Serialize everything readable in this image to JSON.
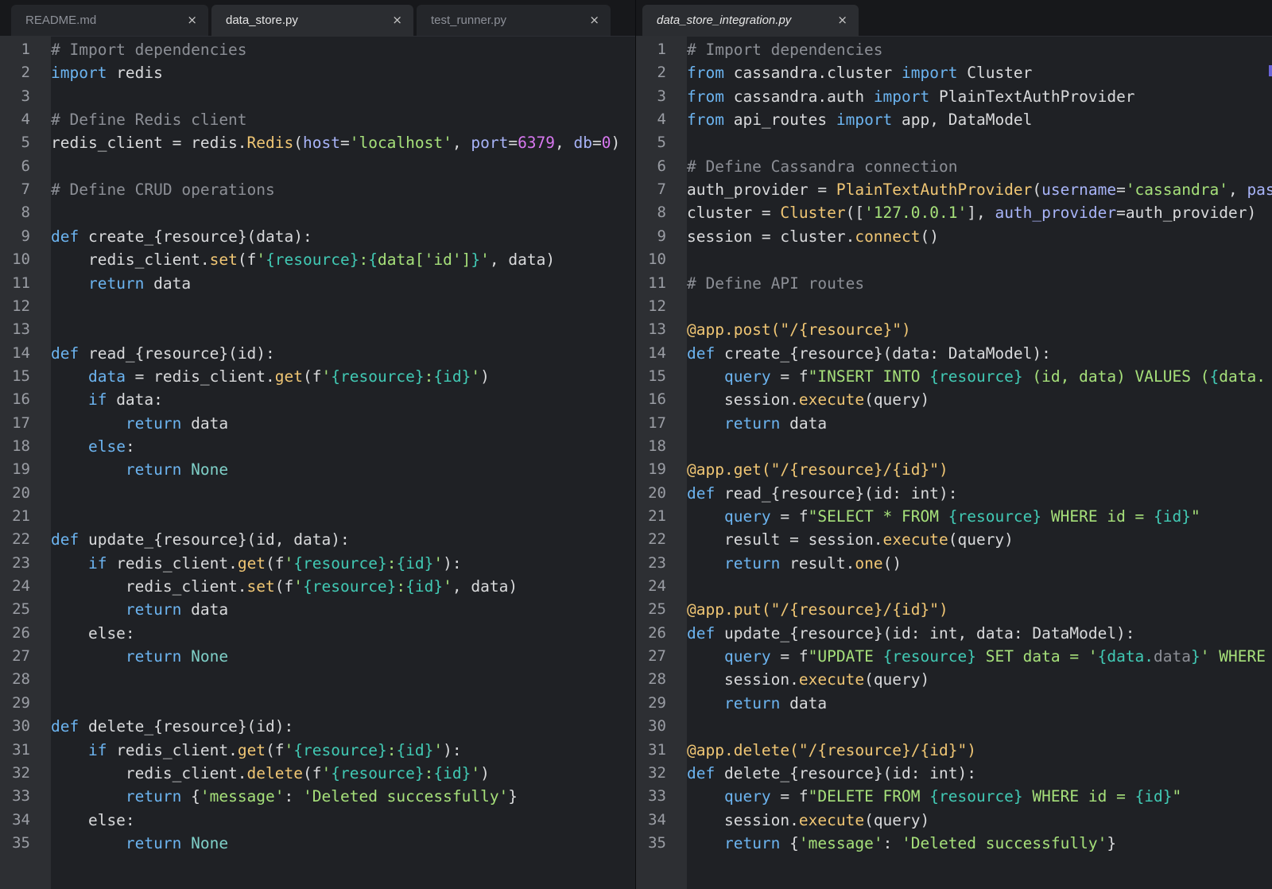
{
  "window": {
    "title": "data_store_integration.py"
  },
  "panes": [
    {
      "id": "left",
      "tabs": [
        {
          "label": "README.md",
          "active": false
        },
        {
          "label": "data_store.py",
          "active": true
        },
        {
          "label": "test_runner.py",
          "active": false
        }
      ],
      "close_glyph": "×",
      "lines": [
        [
          {
            "t": "cm",
            "v": "# Import dependencies"
          }
        ],
        [
          {
            "t": "kw",
            "v": "import"
          },
          {
            "t": "tx",
            "v": " redis"
          }
        ],
        [],
        [
          {
            "t": "cm",
            "v": "# Define Redis client"
          }
        ],
        [
          {
            "t": "tx",
            "v": "redis_client = redis."
          },
          {
            "t": "cls",
            "v": "Redis"
          },
          {
            "t": "tx",
            "v": "("
          },
          {
            "t": "arg",
            "v": "host"
          },
          {
            "t": "tx",
            "v": "="
          },
          {
            "t": "str",
            "v": "'localhost'"
          },
          {
            "t": "tx",
            "v": ", "
          },
          {
            "t": "arg",
            "v": "port"
          },
          {
            "t": "tx",
            "v": "="
          },
          {
            "t": "num",
            "v": "6379"
          },
          {
            "t": "tx",
            "v": ", "
          },
          {
            "t": "arg",
            "v": "db"
          },
          {
            "t": "tx",
            "v": "="
          },
          {
            "t": "num",
            "v": "0"
          },
          {
            "t": "tx",
            "v": ")"
          }
        ],
        [],
        [
          {
            "t": "cm",
            "v": "# Define CRUD operations"
          }
        ],
        [],
        [
          {
            "t": "kw",
            "v": "def"
          },
          {
            "t": "tx",
            "v": " create_{resource}(data):"
          }
        ],
        [
          {
            "t": "tx",
            "v": "    redis_client."
          },
          {
            "t": "fn",
            "v": "set"
          },
          {
            "t": "tx",
            "v": "(f"
          },
          {
            "t": "str",
            "v": "'"
          },
          {
            "t": "ip",
            "v": "{resource}"
          },
          {
            "t": "str",
            "v": ":"
          },
          {
            "t": "ip",
            "v": "{"
          },
          {
            "t": "str",
            "v": "data['id']"
          },
          {
            "t": "ip",
            "v": "}"
          },
          {
            "t": "str",
            "v": "'"
          },
          {
            "t": "tx",
            "v": ", data)"
          }
        ],
        [
          {
            "t": "tx",
            "v": "    "
          },
          {
            "t": "kw",
            "v": "return"
          },
          {
            "t": "tx",
            "v": " data"
          }
        ],
        [],
        [],
        [
          {
            "t": "kw",
            "v": "def"
          },
          {
            "t": "tx",
            "v": " read_{resource}(id):"
          }
        ],
        [
          {
            "t": "tx",
            "v": "    "
          },
          {
            "t": "kw",
            "v": "data"
          },
          {
            "t": "tx",
            "v": " = redis_client."
          },
          {
            "t": "fn",
            "v": "get"
          },
          {
            "t": "tx",
            "v": "(f"
          },
          {
            "t": "str",
            "v": "'"
          },
          {
            "t": "ip",
            "v": "{resource}"
          },
          {
            "t": "str",
            "v": ":"
          },
          {
            "t": "ip",
            "v": "{id}"
          },
          {
            "t": "str",
            "v": "'"
          },
          {
            "t": "tx",
            "v": ")"
          }
        ],
        [
          {
            "t": "tx",
            "v": "    "
          },
          {
            "t": "kw",
            "v": "if"
          },
          {
            "t": "tx",
            "v": " data:"
          }
        ],
        [
          {
            "t": "tx",
            "v": "        "
          },
          {
            "t": "kw",
            "v": "return"
          },
          {
            "t": "tx",
            "v": " data"
          }
        ],
        [
          {
            "t": "tx",
            "v": "    "
          },
          {
            "t": "kw",
            "v": "else"
          },
          {
            "t": "tx",
            "v": ":"
          }
        ],
        [
          {
            "t": "tx",
            "v": "        "
          },
          {
            "t": "kw",
            "v": "return"
          },
          {
            "t": "tx",
            "v": " "
          },
          {
            "t": "bi",
            "v": "None"
          }
        ],
        [],
        [],
        [
          {
            "t": "kw",
            "v": "def"
          },
          {
            "t": "tx",
            "v": " update_{resource}(id, data):"
          }
        ],
        [
          {
            "t": "tx",
            "v": "    "
          },
          {
            "t": "kw",
            "v": "if"
          },
          {
            "t": "tx",
            "v": " redis_client."
          },
          {
            "t": "fn",
            "v": "get"
          },
          {
            "t": "tx",
            "v": "(f"
          },
          {
            "t": "str",
            "v": "'"
          },
          {
            "t": "ip",
            "v": "{resource}"
          },
          {
            "t": "str",
            "v": ":"
          },
          {
            "t": "ip",
            "v": "{id}"
          },
          {
            "t": "str",
            "v": "'"
          },
          {
            "t": "tx",
            "v": "):"
          }
        ],
        [
          {
            "t": "tx",
            "v": "        redis_client."
          },
          {
            "t": "fn",
            "v": "set"
          },
          {
            "t": "tx",
            "v": "(f"
          },
          {
            "t": "str",
            "v": "'"
          },
          {
            "t": "ip",
            "v": "{resource}"
          },
          {
            "t": "str",
            "v": ":"
          },
          {
            "t": "ip",
            "v": "{id}"
          },
          {
            "t": "str",
            "v": "'"
          },
          {
            "t": "tx",
            "v": ", data)"
          }
        ],
        [
          {
            "t": "tx",
            "v": "        "
          },
          {
            "t": "kw",
            "v": "return"
          },
          {
            "t": "tx",
            "v": " data"
          }
        ],
        [
          {
            "t": "tx",
            "v": "    else:"
          }
        ],
        [
          {
            "t": "tx",
            "v": "        "
          },
          {
            "t": "kw",
            "v": "return"
          },
          {
            "t": "tx",
            "v": " "
          },
          {
            "t": "bi",
            "v": "None"
          }
        ],
        [],
        [],
        [
          {
            "t": "kw",
            "v": "def"
          },
          {
            "t": "tx",
            "v": " delete_{resource}(id):"
          }
        ],
        [
          {
            "t": "tx",
            "v": "    "
          },
          {
            "t": "kw",
            "v": "if"
          },
          {
            "t": "tx",
            "v": " redis_client."
          },
          {
            "t": "fn",
            "v": "get"
          },
          {
            "t": "tx",
            "v": "(f"
          },
          {
            "t": "str",
            "v": "'"
          },
          {
            "t": "ip",
            "v": "{resource}"
          },
          {
            "t": "str",
            "v": ":"
          },
          {
            "t": "ip",
            "v": "{id}"
          },
          {
            "t": "str",
            "v": "'"
          },
          {
            "t": "tx",
            "v": "):"
          }
        ],
        [
          {
            "t": "tx",
            "v": "        redis_client."
          },
          {
            "t": "fn",
            "v": "delete"
          },
          {
            "t": "tx",
            "v": "(f"
          },
          {
            "t": "str",
            "v": "'"
          },
          {
            "t": "ip",
            "v": "{resource}"
          },
          {
            "t": "str",
            "v": ":"
          },
          {
            "t": "ip",
            "v": "{id}"
          },
          {
            "t": "str",
            "v": "'"
          },
          {
            "t": "tx",
            "v": ")"
          }
        ],
        [
          {
            "t": "tx",
            "v": "        "
          },
          {
            "t": "kw",
            "v": "return"
          },
          {
            "t": "tx",
            "v": " {"
          },
          {
            "t": "str",
            "v": "'message'"
          },
          {
            "t": "tx",
            "v": ": "
          },
          {
            "t": "str",
            "v": "'Deleted successfully'"
          },
          {
            "t": "tx",
            "v": "}"
          }
        ],
        [
          {
            "t": "tx",
            "v": "    else:"
          }
        ],
        [
          {
            "t": "tx",
            "v": "        "
          },
          {
            "t": "kw",
            "v": "return"
          },
          {
            "t": "tx",
            "v": " "
          },
          {
            "t": "bi",
            "v": "None"
          }
        ]
      ]
    },
    {
      "id": "right",
      "tabs": [
        {
          "label": "data_store_integration.py",
          "active": true
        }
      ],
      "close_glyph": "×",
      "lines": [
        [
          {
            "t": "cm",
            "v": "# Import dependencies"
          }
        ],
        [
          {
            "t": "kw",
            "v": "from"
          },
          {
            "t": "tx",
            "v": " cassandra.cluster "
          },
          {
            "t": "kw",
            "v": "import"
          },
          {
            "t": "tx",
            "v": " Cluster"
          }
        ],
        [
          {
            "t": "kw",
            "v": "from"
          },
          {
            "t": "tx",
            "v": " cassandra.auth "
          },
          {
            "t": "kw",
            "v": "import"
          },
          {
            "t": "tx",
            "v": " PlainTextAuthProvider"
          }
        ],
        [
          {
            "t": "kw",
            "v": "from"
          },
          {
            "t": "tx",
            "v": " api_routes "
          },
          {
            "t": "kw",
            "v": "import"
          },
          {
            "t": "tx",
            "v": " app, DataModel"
          }
        ],
        [],
        [
          {
            "t": "cm",
            "v": "# Define Cassandra connection"
          }
        ],
        [
          {
            "t": "tx",
            "v": "auth_provider = "
          },
          {
            "t": "cls",
            "v": "PlainTextAuthProvider"
          },
          {
            "t": "tx",
            "v": "("
          },
          {
            "t": "arg",
            "v": "username"
          },
          {
            "t": "tx",
            "v": "="
          },
          {
            "t": "str",
            "v": "'cassandra'"
          },
          {
            "t": "tx",
            "v": ", "
          },
          {
            "t": "arg",
            "v": "pas"
          }
        ],
        [
          {
            "t": "tx",
            "v": "cluster = "
          },
          {
            "t": "cls",
            "v": "Cluster"
          },
          {
            "t": "tx",
            "v": "(["
          },
          {
            "t": "str",
            "v": "'127.0.0.1'"
          },
          {
            "t": "tx",
            "v": "], "
          },
          {
            "t": "arg",
            "v": "auth_provider"
          },
          {
            "t": "tx",
            "v": "=auth_provider)"
          }
        ],
        [
          {
            "t": "tx",
            "v": "session = cluster."
          },
          {
            "t": "fn",
            "v": "connect"
          },
          {
            "t": "tx",
            "v": "()"
          }
        ],
        [],
        [
          {
            "t": "cm",
            "v": "# Define API routes"
          }
        ],
        [],
        [
          {
            "t": "dec",
            "v": "@app.post(\"/{resource}\")"
          }
        ],
        [
          {
            "t": "kw",
            "v": "def"
          },
          {
            "t": "tx",
            "v": " create_{resource}(data: DataModel):"
          }
        ],
        [
          {
            "t": "tx",
            "v": "    "
          },
          {
            "t": "kw",
            "v": "query"
          },
          {
            "t": "tx",
            "v": " = f"
          },
          {
            "t": "str",
            "v": "\"INSERT INTO "
          },
          {
            "t": "ip",
            "v": "{resource}"
          },
          {
            "t": "str",
            "v": " (id, data) VALUES ("
          },
          {
            "t": "ip",
            "v": "{"
          },
          {
            "t": "str",
            "v": "data."
          }
        ],
        [
          {
            "t": "tx",
            "v": "    session."
          },
          {
            "t": "fn",
            "v": "execute"
          },
          {
            "t": "tx",
            "v": "(query)"
          }
        ],
        [
          {
            "t": "tx",
            "v": "    "
          },
          {
            "t": "kw",
            "v": "return"
          },
          {
            "t": "tx",
            "v": " data"
          }
        ],
        [],
        [
          {
            "t": "dec",
            "v": "@app.get(\"/{resource}/{id}\")"
          }
        ],
        [
          {
            "t": "kw",
            "v": "def"
          },
          {
            "t": "tx",
            "v": " read_{resource}(id: int):"
          }
        ],
        [
          {
            "t": "tx",
            "v": "    "
          },
          {
            "t": "kw",
            "v": "query"
          },
          {
            "t": "tx",
            "v": " = f"
          },
          {
            "t": "str",
            "v": "\"SELECT * FROM "
          },
          {
            "t": "ip",
            "v": "{resource}"
          },
          {
            "t": "str",
            "v": " WHERE id = "
          },
          {
            "t": "ip",
            "v": "{id}"
          },
          {
            "t": "str",
            "v": "\""
          }
        ],
        [
          {
            "t": "tx",
            "v": "    result = session."
          },
          {
            "t": "fn",
            "v": "execute"
          },
          {
            "t": "tx",
            "v": "(query)"
          }
        ],
        [
          {
            "t": "tx",
            "v": "    "
          },
          {
            "t": "kw",
            "v": "return"
          },
          {
            "t": "tx",
            "v": " result."
          },
          {
            "t": "fn",
            "v": "one"
          },
          {
            "t": "tx",
            "v": "()"
          }
        ],
        [],
        [
          {
            "t": "dec",
            "v": "@app.put(\"/{resource}/{id}\")"
          }
        ],
        [
          {
            "t": "kw",
            "v": "def"
          },
          {
            "t": "tx",
            "v": " update_{resource}(id: int, data: DataModel):"
          }
        ],
        [
          {
            "t": "tx",
            "v": "    "
          },
          {
            "t": "kw",
            "v": "query"
          },
          {
            "t": "tx",
            "v": " = f"
          },
          {
            "t": "str",
            "v": "\"UPDATE "
          },
          {
            "t": "ip",
            "v": "{resource}"
          },
          {
            "t": "str",
            "v": " SET data = '"
          },
          {
            "t": "ip",
            "v": "{data."
          },
          {
            "t": "cm",
            "v": "data"
          },
          {
            "t": "ip",
            "v": "}"
          },
          {
            "t": "str",
            "v": "' WHERE"
          }
        ],
        [
          {
            "t": "tx",
            "v": "    session."
          },
          {
            "t": "fn",
            "v": "execute"
          },
          {
            "t": "tx",
            "v": "(query)"
          }
        ],
        [
          {
            "t": "tx",
            "v": "    "
          },
          {
            "t": "kw",
            "v": "return"
          },
          {
            "t": "tx",
            "v": " data"
          }
        ],
        [],
        [
          {
            "t": "dec",
            "v": "@app.delete(\"/{resource}/{id}\")"
          }
        ],
        [
          {
            "t": "kw",
            "v": "def"
          },
          {
            "t": "tx",
            "v": " delete_{resource}(id: int):"
          }
        ],
        [
          {
            "t": "tx",
            "v": "    "
          },
          {
            "t": "kw",
            "v": "query"
          },
          {
            "t": "tx",
            "v": " = f"
          },
          {
            "t": "str",
            "v": "\"DELETE FROM "
          },
          {
            "t": "ip",
            "v": "{resource}"
          },
          {
            "t": "str",
            "v": " WHERE id = "
          },
          {
            "t": "ip",
            "v": "{id}"
          },
          {
            "t": "str",
            "v": "\""
          }
        ],
        [
          {
            "t": "tx",
            "v": "    session."
          },
          {
            "t": "fn",
            "v": "execute"
          },
          {
            "t": "tx",
            "v": "(query)"
          }
        ],
        [
          {
            "t": "tx",
            "v": "    "
          },
          {
            "t": "kw",
            "v": "return"
          },
          {
            "t": "tx",
            "v": " {"
          },
          {
            "t": "str",
            "v": "'message'"
          },
          {
            "t": "tx",
            "v": ": "
          },
          {
            "t": "str",
            "v": "'Deleted successfully'"
          },
          {
            "t": "tx",
            "v": "}"
          }
        ]
      ]
    }
  ],
  "theme": {
    "background": "#1f2125",
    "gutter": "#2d2f33",
    "comment": "#8c8f96",
    "keyword": "#6cb4f0",
    "function": "#f0c674",
    "string": "#a6e07a",
    "number": "#d878f0",
    "argument": "#a8b4f8",
    "interpolation": "#41c9b4"
  }
}
